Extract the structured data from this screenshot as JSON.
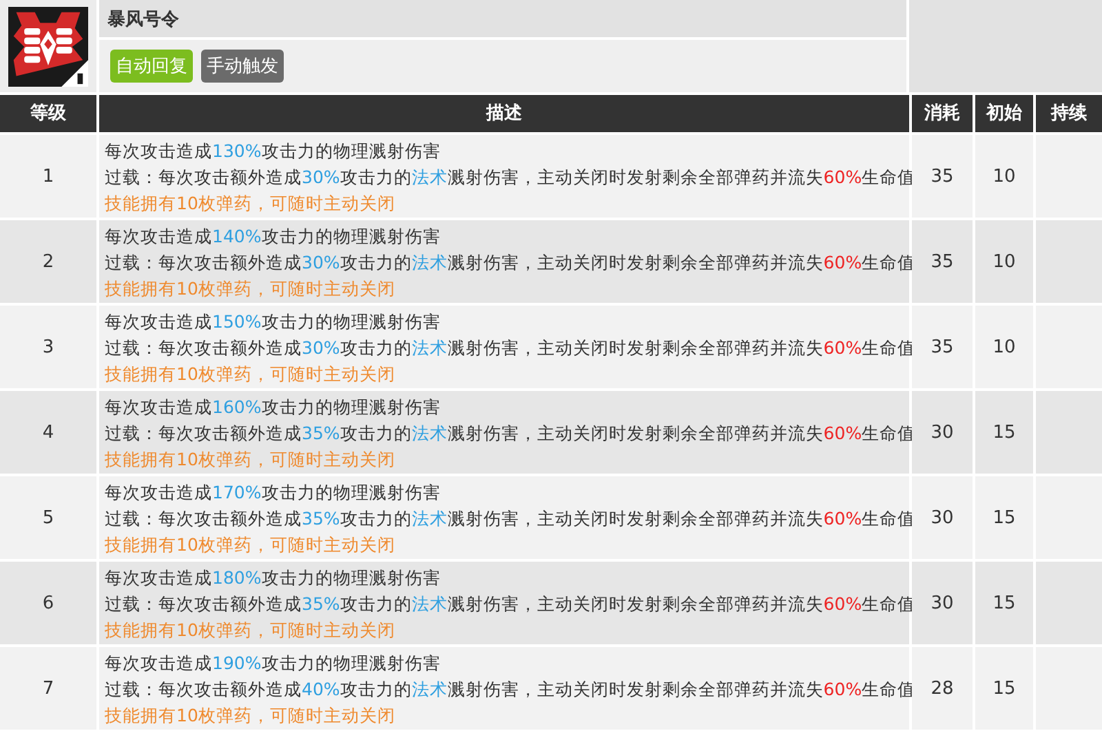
{
  "skill": {
    "name": "暴风号令",
    "tags": [
      {
        "label": "自动回复",
        "color": "#7cbd1f"
      },
      {
        "label": "手动触发",
        "color": "#6b6b6b"
      }
    ]
  },
  "table": {
    "columns": [
      "等级",
      "描述",
      "消耗",
      "初始",
      "持续"
    ],
    "rows": [
      {
        "level": "1",
        "lines": [
          [
            {
              "text": "每次攻击造成",
              "kind": "plain"
            },
            {
              "text": "130%",
              "kind": "value"
            },
            {
              "text": "攻击力的物理溅射伤害",
              "kind": "plain"
            }
          ],
          [
            {
              "text": "过载：每次攻击额外造成",
              "kind": "plain"
            },
            {
              "text": "30%",
              "kind": "value"
            },
            {
              "text": "攻击力的",
              "kind": "plain"
            },
            {
              "text": "法术",
              "kind": "value"
            },
            {
              "text": "溅射伤害，主动关闭时发射剩余全部弹药并流失",
              "kind": "plain"
            },
            {
              "text": "60%",
              "kind": "penalty"
            },
            {
              "text": "生命值",
              "kind": "plain"
            }
          ],
          [
            {
              "text": "技能拥有10枚弹药，可随时主动关闭",
              "kind": "note"
            }
          ]
        ],
        "cost": "35",
        "initial": "10"
      },
      {
        "level": "2",
        "lines": [
          [
            {
              "text": "每次攻击造成",
              "kind": "plain"
            },
            {
              "text": "140%",
              "kind": "value"
            },
            {
              "text": "攻击力的物理溅射伤害",
              "kind": "plain"
            }
          ],
          [
            {
              "text": "过载：每次攻击额外造成",
              "kind": "plain"
            },
            {
              "text": "30%",
              "kind": "value"
            },
            {
              "text": "攻击力的",
              "kind": "plain"
            },
            {
              "text": "法术",
              "kind": "value"
            },
            {
              "text": "溅射伤害，主动关闭时发射剩余全部弹药并流失",
              "kind": "plain"
            },
            {
              "text": "60%",
              "kind": "penalty"
            },
            {
              "text": "生命值",
              "kind": "plain"
            }
          ],
          [
            {
              "text": "技能拥有10枚弹药，可随时主动关闭",
              "kind": "note"
            }
          ]
        ],
        "cost": "35",
        "initial": "10"
      },
      {
        "level": "3",
        "lines": [
          [
            {
              "text": "每次攻击造成",
              "kind": "plain"
            },
            {
              "text": "150%",
              "kind": "value"
            },
            {
              "text": "攻击力的物理溅射伤害",
              "kind": "plain"
            }
          ],
          [
            {
              "text": "过载：每次攻击额外造成",
              "kind": "plain"
            },
            {
              "text": "30%",
              "kind": "value"
            },
            {
              "text": "攻击力的",
              "kind": "plain"
            },
            {
              "text": "法术",
              "kind": "value"
            },
            {
              "text": "溅射伤害，主动关闭时发射剩余全部弹药并流失",
              "kind": "plain"
            },
            {
              "text": "60%",
              "kind": "penalty"
            },
            {
              "text": "生命值",
              "kind": "plain"
            }
          ],
          [
            {
              "text": "技能拥有10枚弹药，可随时主动关闭",
              "kind": "note"
            }
          ]
        ],
        "cost": "35",
        "initial": "10"
      },
      {
        "level": "4",
        "lines": [
          [
            {
              "text": "每次攻击造成",
              "kind": "plain"
            },
            {
              "text": "160%",
              "kind": "value"
            },
            {
              "text": "攻击力的物理溅射伤害",
              "kind": "plain"
            }
          ],
          [
            {
              "text": "过载：每次攻击额外造成",
              "kind": "plain"
            },
            {
              "text": "35%",
              "kind": "value"
            },
            {
              "text": "攻击力的",
              "kind": "plain"
            },
            {
              "text": "法术",
              "kind": "value"
            },
            {
              "text": "溅射伤害，主动关闭时发射剩余全部弹药并流失",
              "kind": "plain"
            },
            {
              "text": "60%",
              "kind": "penalty"
            },
            {
              "text": "生命值",
              "kind": "plain"
            }
          ],
          [
            {
              "text": "技能拥有10枚弹药，可随时主动关闭",
              "kind": "note"
            }
          ]
        ],
        "cost": "30",
        "initial": "15"
      },
      {
        "level": "5",
        "lines": [
          [
            {
              "text": "每次攻击造成",
              "kind": "plain"
            },
            {
              "text": "170%",
              "kind": "value"
            },
            {
              "text": "攻击力的物理溅射伤害",
              "kind": "plain"
            }
          ],
          [
            {
              "text": "过载：每次攻击额外造成",
              "kind": "plain"
            },
            {
              "text": "35%",
              "kind": "value"
            },
            {
              "text": "攻击力的",
              "kind": "plain"
            },
            {
              "text": "法术",
              "kind": "value"
            },
            {
              "text": "溅射伤害，主动关闭时发射剩余全部弹药并流失",
              "kind": "plain"
            },
            {
              "text": "60%",
              "kind": "penalty"
            },
            {
              "text": "生命值",
              "kind": "plain"
            }
          ],
          [
            {
              "text": "技能拥有10枚弹药，可随时主动关闭",
              "kind": "note"
            }
          ]
        ],
        "cost": "30",
        "initial": "15"
      },
      {
        "level": "6",
        "lines": [
          [
            {
              "text": "每次攻击造成",
              "kind": "plain"
            },
            {
              "text": "180%",
              "kind": "value"
            },
            {
              "text": "攻击力的物理溅射伤害",
              "kind": "plain"
            }
          ],
          [
            {
              "text": "过载：每次攻击额外造成",
              "kind": "plain"
            },
            {
              "text": "35%",
              "kind": "value"
            },
            {
              "text": "攻击力的",
              "kind": "plain"
            },
            {
              "text": "法术",
              "kind": "value"
            },
            {
              "text": "溅射伤害，主动关闭时发射剩余全部弹药并流失",
              "kind": "plain"
            },
            {
              "text": "60%",
              "kind": "penalty"
            },
            {
              "text": "生命值",
              "kind": "plain"
            }
          ],
          [
            {
              "text": "技能拥有10枚弹药，可随时主动关闭",
              "kind": "note"
            }
          ]
        ],
        "cost": "30",
        "initial": "15"
      },
      {
        "level": "7",
        "lines": [
          [
            {
              "text": "每次攻击造成",
              "kind": "plain"
            },
            {
              "text": "190%",
              "kind": "value"
            },
            {
              "text": "攻击力的物理溅射伤害",
              "kind": "plain"
            }
          ],
          [
            {
              "text": "过载：每次攻击额外造成",
              "kind": "plain"
            },
            {
              "text": "40%",
              "kind": "value"
            },
            {
              "text": "攻击力的",
              "kind": "plain"
            },
            {
              "text": "法术",
              "kind": "value"
            },
            {
              "text": "溅射伤害，主动关闭时发射剩余全部弹药并流失",
              "kind": "plain"
            },
            {
              "text": "60%",
              "kind": "penalty"
            },
            {
              "text": "生命值",
              "kind": "plain"
            }
          ],
          [
            {
              "text": "技能拥有10枚弹药，可随时主动关闭",
              "kind": "note"
            }
          ]
        ],
        "cost": "28",
        "initial": "15"
      }
    ]
  }
}
